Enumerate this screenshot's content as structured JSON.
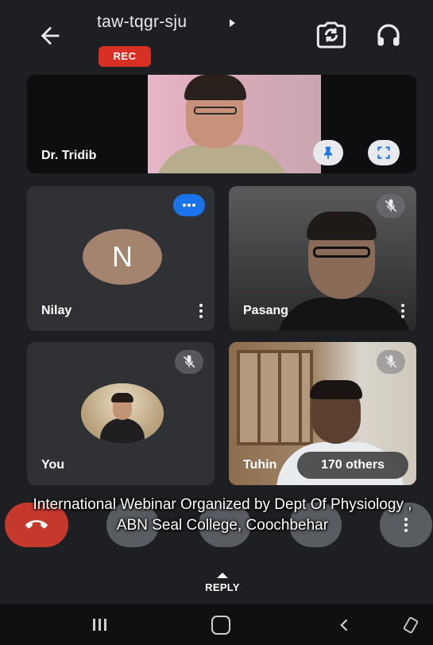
{
  "meeting": {
    "code": "taw-tqgr-sju",
    "recording_badge": "REC"
  },
  "icons": {
    "back": "arrow-left-icon",
    "camera_switch": "camera-switch-icon",
    "audio_output": "headset-icon",
    "pin": "pin-icon",
    "fullscreen": "fullscreen-icon",
    "muted": "mic-off-icon",
    "speaking": "speaking-indicator-icon",
    "more": "more-vert-icon"
  },
  "participants": {
    "host": {
      "name": "Dr. Tridib"
    },
    "nilay": {
      "name": "Nilay",
      "avatar_letter": "N",
      "avatar_color": "#a4846f"
    },
    "pasang": {
      "name": "Pasang"
    },
    "you": {
      "name": "You"
    },
    "tuhin": {
      "name": "Tuhin",
      "others_count_label": "170 others"
    }
  },
  "caption": {
    "text": "International Webinar Organized by Dept Of Physiology , ABN Seal College, Coochbehar"
  },
  "reply": {
    "label": "REPLY"
  },
  "colors": {
    "end_call": "#c5392c",
    "rec": "#d93025",
    "speaking": "#1a73e8",
    "background": "#1e1f22"
  }
}
